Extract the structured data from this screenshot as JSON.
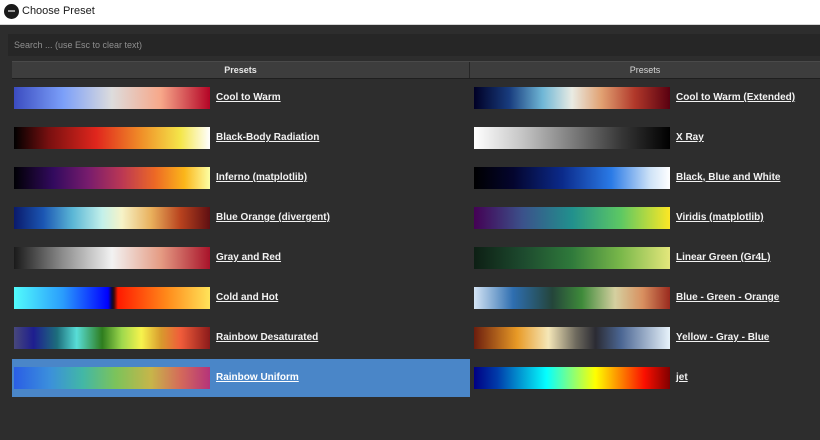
{
  "window": {
    "title": "Choose Preset"
  },
  "search": {
    "placeholder": "Search ... (use Esc to clear text)"
  },
  "columns": [
    "Presets",
    "Presets"
  ],
  "presets_left": [
    {
      "label": "Cool to Warm",
      "selected": false,
      "gradient": "linear-gradient(90deg,#3b4cc0 0%,#7b9ff9 25%,#dddcdc 50%,#f7a789 75%,#b40426 100%)"
    },
    {
      "label": "Black-Body Radiation",
      "selected": false,
      "gradient": "linear-gradient(90deg,#000000 0%,#7a1010 18%,#e0261d 42%,#f08f28 65%,#f4e64a 85%,#ffffff 100%)"
    },
    {
      "label": "Inferno (matplotlib)",
      "selected": false,
      "gradient": "linear-gradient(90deg,#000004 0%,#320a5e 20%,#781c6d 38%,#bb3754 55%,#ed6925 72%,#fbb61a 87%,#fcffa4 100%)"
    },
    {
      "label": "Blue Orange (divergent)",
      "selected": false,
      "gradient": "linear-gradient(90deg,#0a1a6b 0%,#1b56b3 15%,#5bb7d6 30%,#c3f0ea 45%,#f6f3c8 55%,#e9b05c 70%,#b8421e 85%,#5f0f12 100%)"
    },
    {
      "label": "Gray and Red",
      "selected": false,
      "gradient": "linear-gradient(90deg,#1a1a1a 0%,#8d8d8d 25%,#f2f2f2 50%,#e59b83 75%,#a8132a 100%)"
    },
    {
      "label": "Cold and Hot",
      "selected": false,
      "gradient": "linear-gradient(90deg,#52fcfc 0%,#2a9cfc 25%,#0000ff 48%,#0a0a3a 50%,#3a0a0a 51%,#ff1a00 53%,#ff8a1a 78%,#ffe45a 100%)"
    },
    {
      "label": "Rainbow Desaturated",
      "selected": false,
      "gradient": "linear-gradient(90deg,#47477b 0%,#1e1e8f 10%,#1d6e7c 22%,#58ddd7 32%,#2e7d1e 45%,#9ed84d 55%,#f7f34d 65%,#d89a2d 75%,#f05c3a 85%,#8b1a1a 100%)"
    },
    {
      "label": "Rainbow Uniform",
      "selected": true,
      "gradient": "linear-gradient(90deg,#2a5ee5 0%,#3b8fdc 18%,#42b7a6 35%,#7cc35a 52%,#c7b54a 70%,#d46a5a 85%,#b5337a 100%)"
    }
  ],
  "presets_right": [
    {
      "label": "Cool to Warm (Extended)",
      "selected": false,
      "gradient": "linear-gradient(90deg,#000025 0%,#183c7e 18%,#6fb7d6 35%,#e9ebe3 50%,#e1a172 65%,#b1382a 82%,#590010 100%)"
    },
    {
      "label": "X Ray",
      "selected": false,
      "gradient": "linear-gradient(90deg,#ffffff 0%,#c4c4c4 25%,#7d7d7d 50%,#373737 75%,#000000 100%)"
    },
    {
      "label": "Black, Blue and White",
      "selected": false,
      "gradient": "linear-gradient(90deg,#000000 0%,#04052e 20%,#0b2a8a 45%,#2a7ae6 70%,#cfe3f7 90%,#ffffff 100%)"
    },
    {
      "label": "Viridis (matplotlib)",
      "selected": false,
      "gradient": "linear-gradient(90deg,#440154 0%,#3b528b 25%,#21908d 50%,#5dc863 75%,#fde725 100%)"
    },
    {
      "label": "Linear Green (Gr4L)",
      "selected": false,
      "gradient": "linear-gradient(90deg,#0d1f14 0%,#1d4a2e 25%,#2f7a3b 50%,#7ab84a 75%,#e4e77c 100%)"
    },
    {
      "label": "Blue - Green - Orange",
      "selected": false,
      "gradient": "linear-gradient(90deg,#d5e5f5 0%,#2e6eb0 20%,#24453a 40%,#3e8a3a 55%,#d5d0a0 72%,#d89060 86%,#9a2a1e 100%)"
    },
    {
      "label": "Yellow - Gray - Blue",
      "selected": false,
      "gradient": "linear-gradient(90deg,#6b1d0e 0%,#e89a26 22%,#f5e7b8 38%,#6e6a5e 52%,#2b2b33 62%,#4b6693 75%,#e8f3fb 100%)"
    },
    {
      "label": "jet",
      "selected": false,
      "gradient": "linear-gradient(90deg,#000083 0%,#003caa 12%,#05ffff 37%,#ffff00 62%,#fa0f00 87%,#800000 100%)"
    }
  ]
}
